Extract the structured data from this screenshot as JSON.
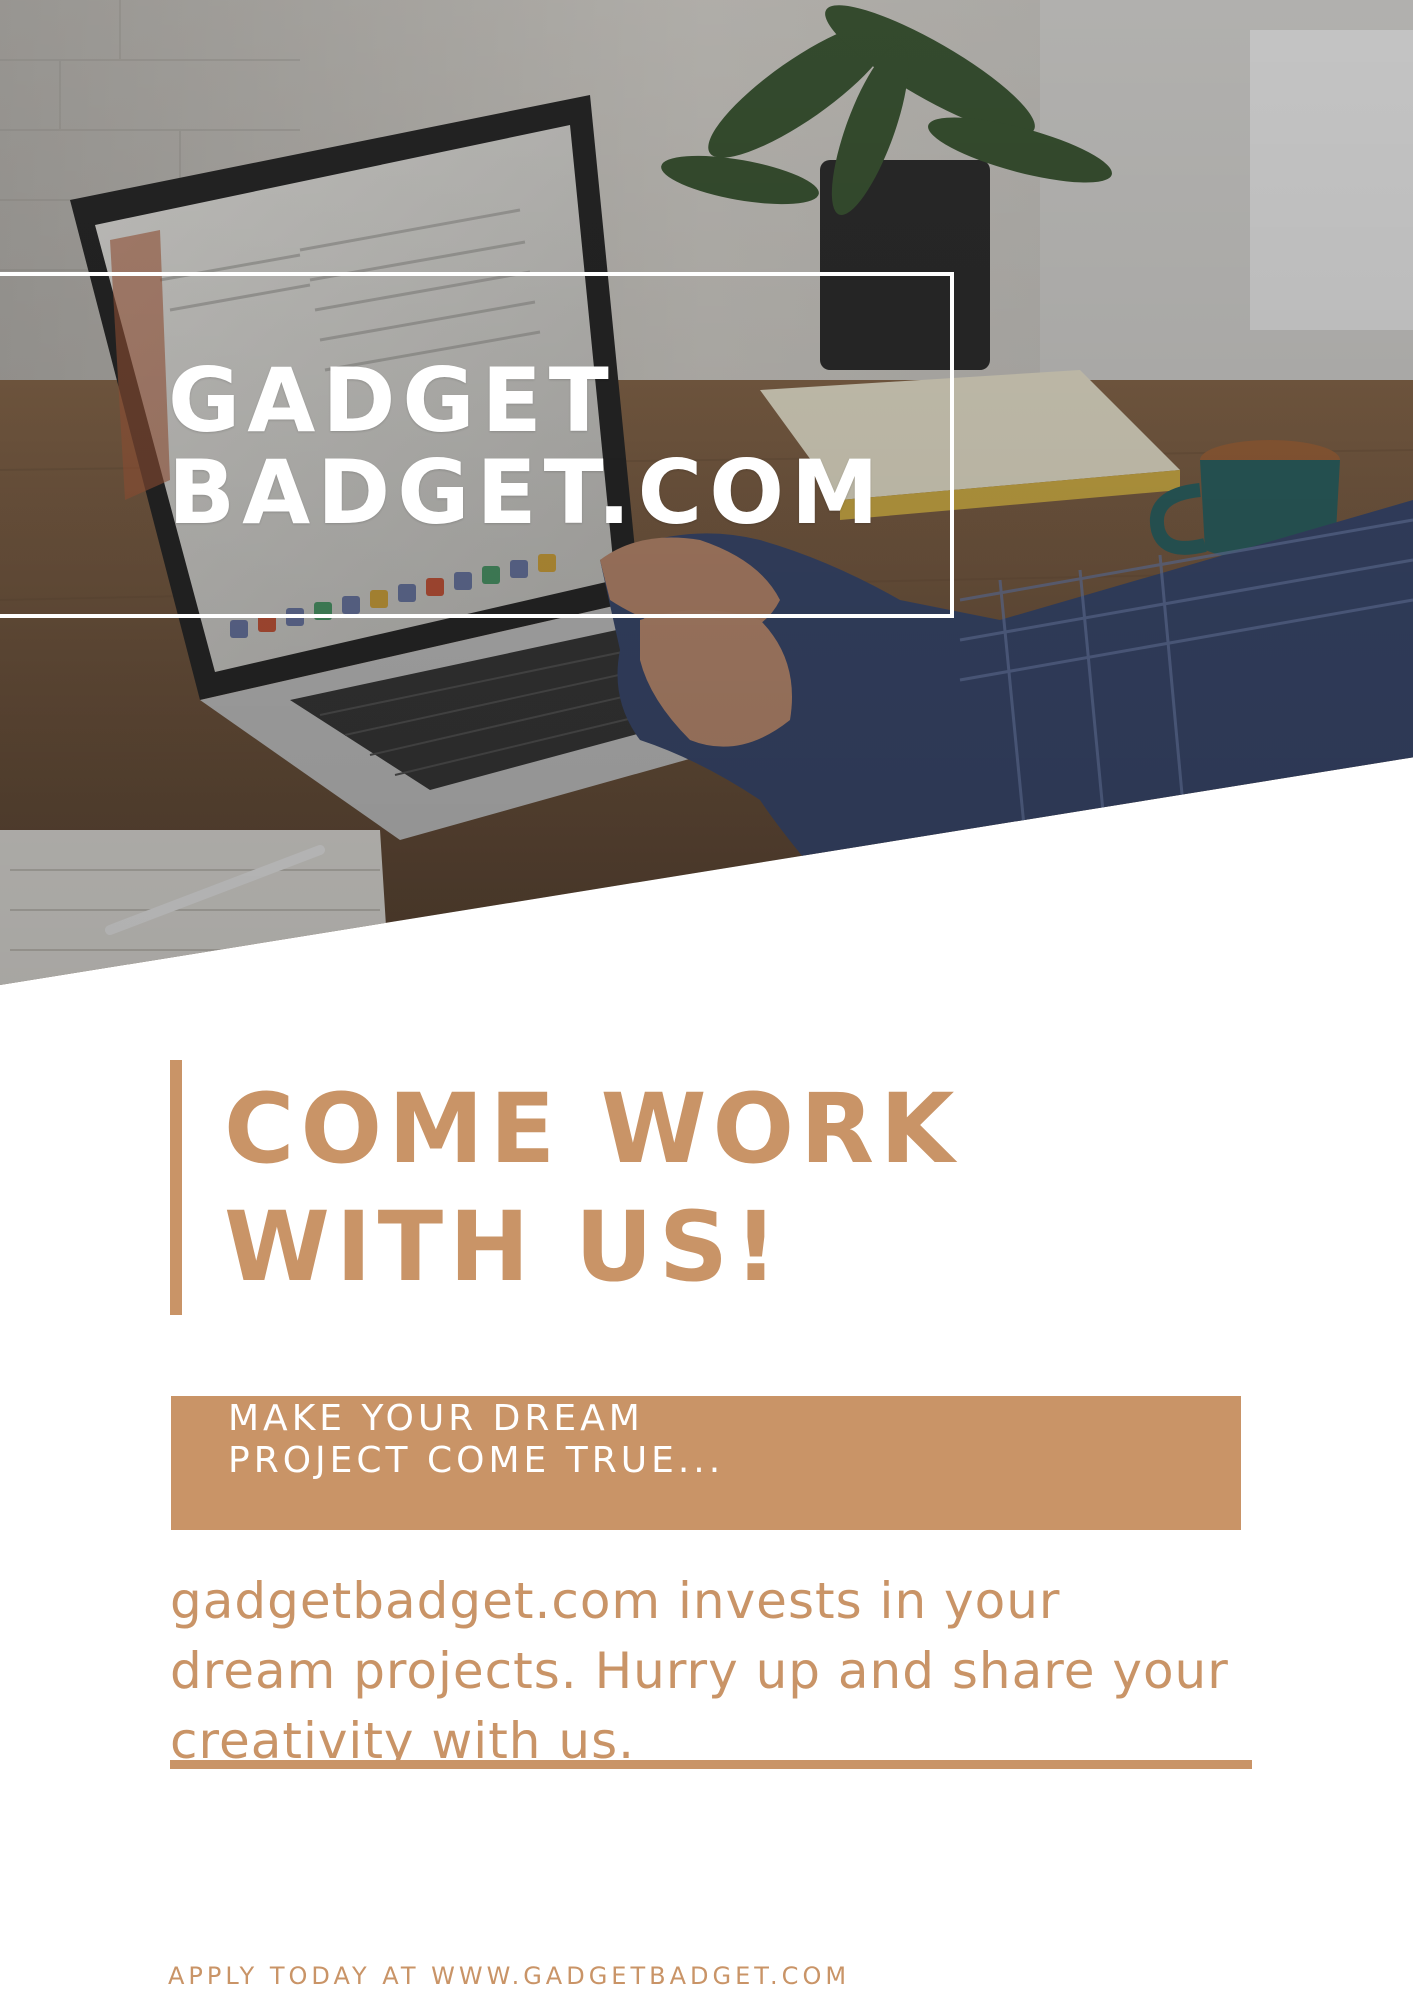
{
  "logo": {
    "line1": "GADGET",
    "line2": "BADGET.COM"
  },
  "headline": {
    "line1": "COME WORK",
    "line2": "WITH US!"
  },
  "banner": {
    "line1": "MAKE YOUR DREAM",
    "line2": "PROJECT COME TRUE..."
  },
  "body": {
    "line1": "gadgetbadget.com invests in your",
    "line2": "dream projects. Hurry up and share your",
    "line3": "creativity with us."
  },
  "footer": {
    "text": "APPLY TODAY AT WWW.GADGETBADGET.COM"
  },
  "colors": {
    "accent": "#c99467",
    "background": "#ffffff",
    "logo_text": "#ffffff"
  }
}
